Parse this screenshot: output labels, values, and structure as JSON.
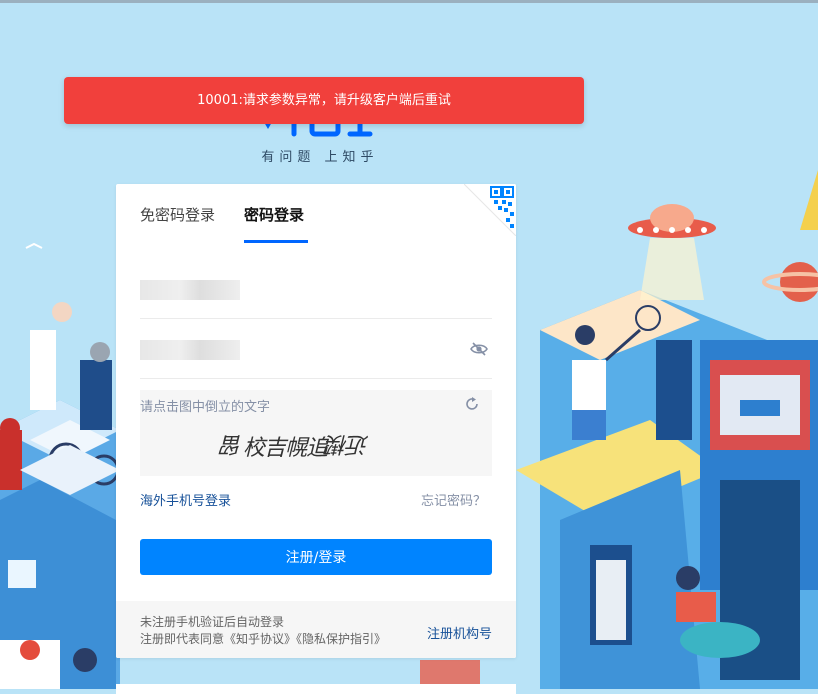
{
  "toast": {
    "message": "10001:请求参数异常，请升级客户端后重试"
  },
  "logo": {
    "slogan": "有问题 上知乎"
  },
  "tabs": [
    {
      "label": "免密码登录",
      "active": false
    },
    {
      "label": "密码登录",
      "active": true
    }
  ],
  "form": {
    "account_masked": true,
    "password_masked": true,
    "captcha_hint": "请点击图中倒立的文字",
    "captcha_chars": [
      "留",
      "校",
      "吉",
      "幌",
      "追",
      "楔",
      "近"
    ],
    "overseas_link": "海外手机号登录",
    "forgot_link": "忘记密码？",
    "submit_label": "注册/登录"
  },
  "footer": {
    "line1": "未注册手机验证后自动登录",
    "line2_prefix": "注册即代表同意",
    "agreement": "《知乎协议》",
    "privacy": "《隐私保护指引》",
    "org_link": "注册机构号"
  },
  "colors": {
    "toast_bg": "#f1403c",
    "primary": "#0084ff",
    "tab_underline": "#0066ff",
    "link": "#175199",
    "background": "#b9e3f7"
  },
  "icons": [
    "qr-code-icon",
    "eye-off-icon",
    "refresh-icon"
  ]
}
